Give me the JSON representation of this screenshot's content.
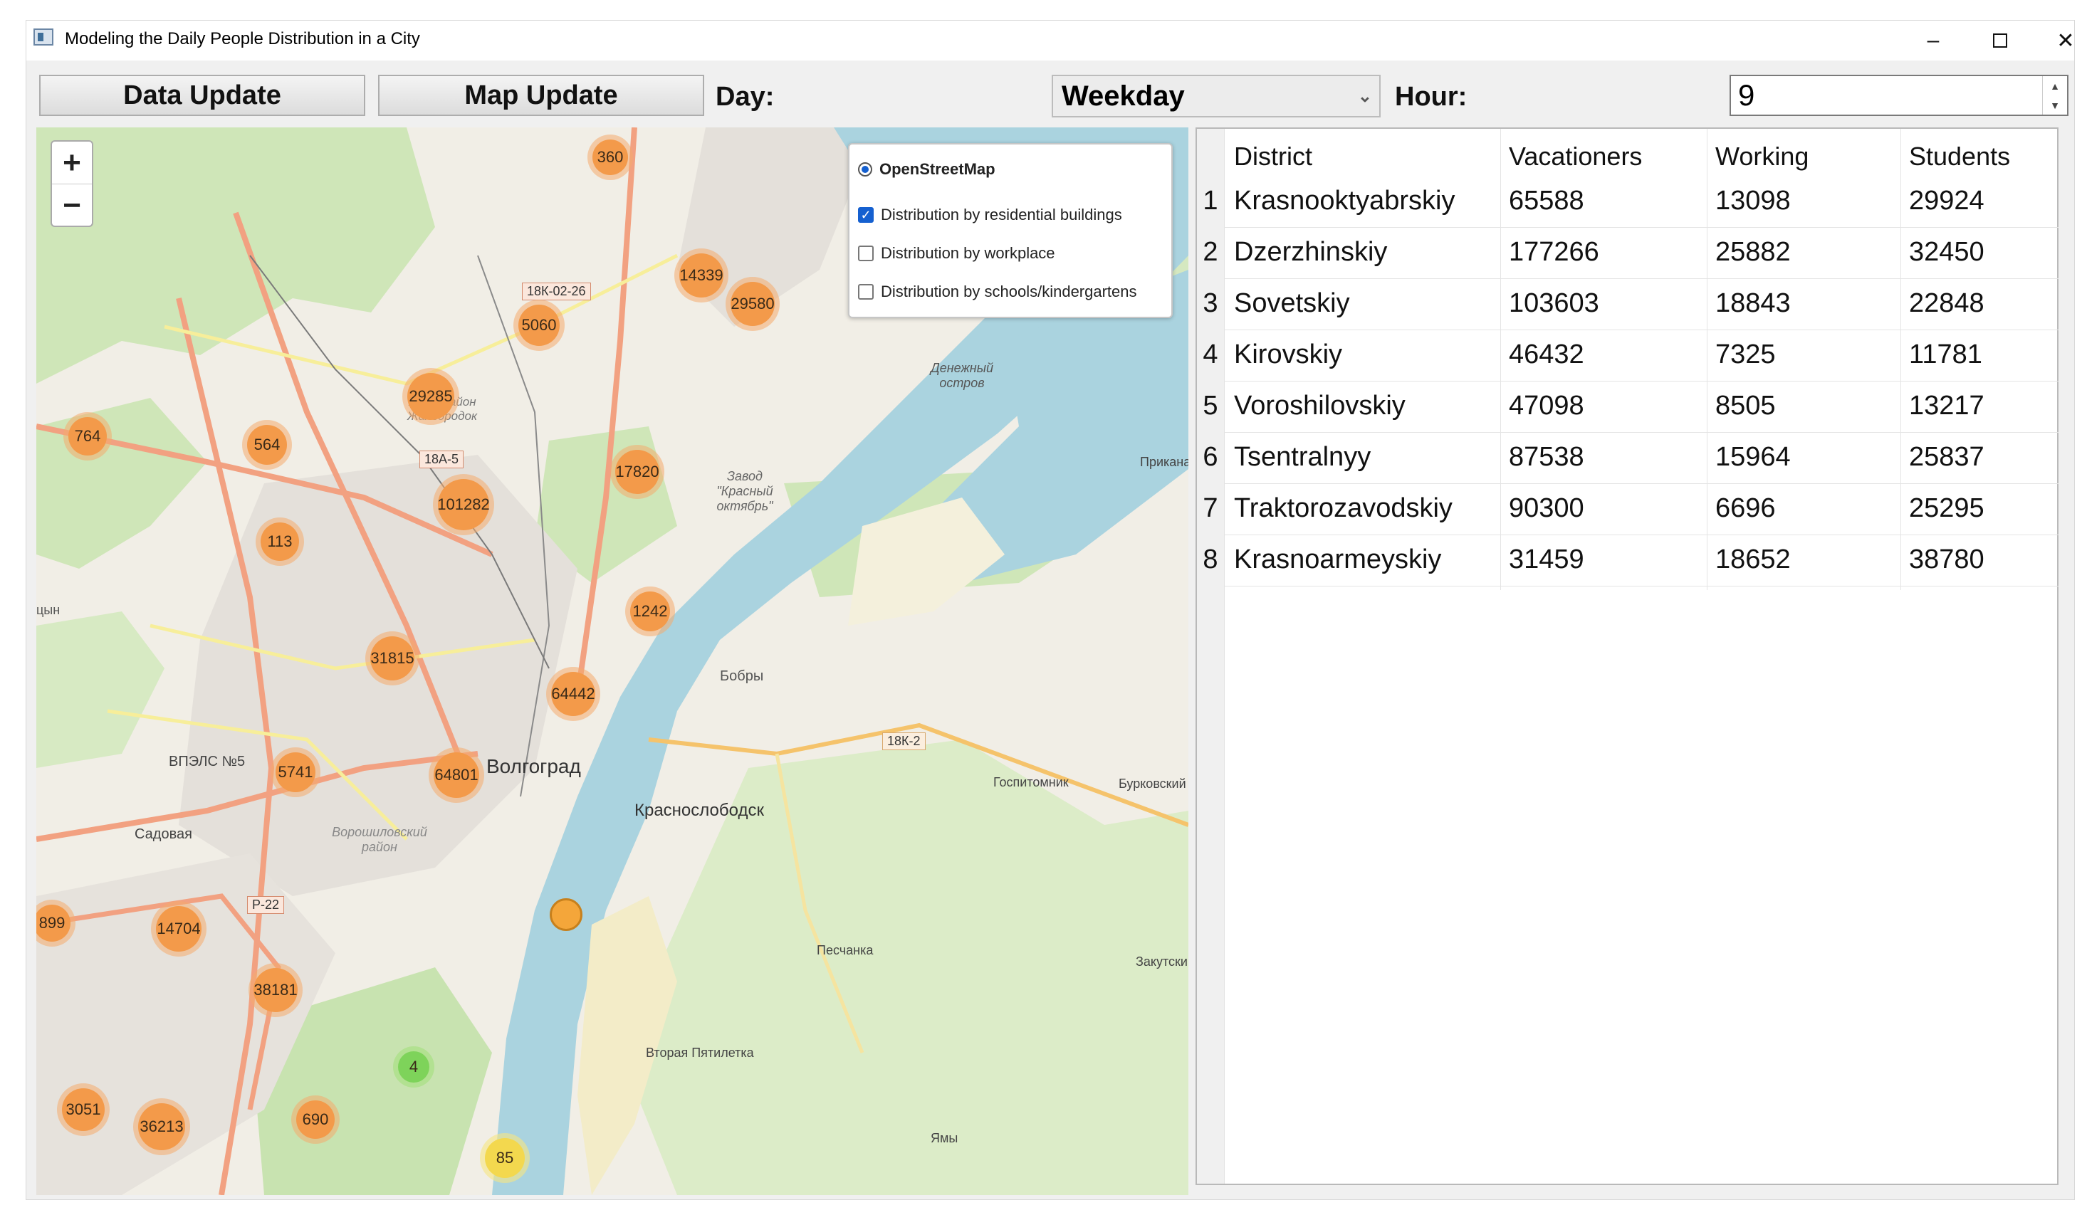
{
  "window": {
    "title": "Modeling the Daily People Distribution in a City"
  },
  "toolbar": {
    "data_update": "Data Update",
    "map_update": "Map Update",
    "day_label": "Day:",
    "day_value": "Weekday",
    "hour_label": "Hour:",
    "hour_value": "9"
  },
  "map": {
    "zoom_in": "+",
    "zoom_out": "−",
    "layers": {
      "base": "OpenStreetMap",
      "overlays": [
        {
          "label": "Distribution by residential buildings",
          "checked": true
        },
        {
          "label": "Distribution by workplace",
          "checked": false
        },
        {
          "label": "Distribution by schools/kindergartens",
          "checked": false
        }
      ]
    },
    "place_labels": [
      "Волгоград",
      "Краснослободск",
      "Бобры",
      "Денежный остров",
      "Завод \"Красный октябрь\"",
      "ВПЭЛС №5",
      "Садовая",
      "Ворошиловский район",
      "Госпитомник",
      "Бурковский",
      "Песчанка",
      "Вторая Пятилетка",
      "Ямы",
      "Закутский",
      "Приканальный",
      "микрорайон Жилгородок",
      "цын"
    ],
    "road_labels": [
      "18К-02-26",
      "18А-5",
      "18К-2",
      "Р-22"
    ],
    "clusters": [
      {
        "label": "360",
        "color": "orange"
      },
      {
        "label": "14339",
        "color": "orange"
      },
      {
        "label": "29580",
        "color": "orange"
      },
      {
        "label": "5060",
        "color": "orange"
      },
      {
        "label": "29285",
        "color": "orange"
      },
      {
        "label": "764",
        "color": "orange"
      },
      {
        "label": "564",
        "color": "orange"
      },
      {
        "label": "17820",
        "color": "orange"
      },
      {
        "label": "101282",
        "color": "orange"
      },
      {
        "label": "113",
        "color": "orange"
      },
      {
        "label": "1242",
        "color": "orange"
      },
      {
        "label": "31815",
        "color": "orange"
      },
      {
        "label": "64442",
        "color": "orange"
      },
      {
        "label": "5741",
        "color": "orange"
      },
      {
        "label": "64801",
        "color": "orange"
      },
      {
        "label": "899",
        "color": "orange"
      },
      {
        "label": "14704",
        "color": "orange"
      },
      {
        "label": "38181",
        "color": "orange"
      },
      {
        "label": "4",
        "color": "green"
      },
      {
        "label": "690",
        "color": "orange"
      },
      {
        "label": "3051",
        "color": "orange"
      },
      {
        "label": "36213",
        "color": "orange"
      },
      {
        "label": "85",
        "color": "yellow"
      },
      {
        "label": "",
        "color": "orange-marker"
      }
    ]
  },
  "table": {
    "headers": [
      "District",
      "Vacationers",
      "Working",
      "Students"
    ],
    "rows": [
      [
        "1",
        "Krasnooktyabrskiy",
        "65588",
        "13098",
        "29924"
      ],
      [
        "2",
        "Dzerzhinskiy",
        "177266",
        "25882",
        "32450"
      ],
      [
        "3",
        "Sovetskiy",
        "103603",
        "18843",
        "22848"
      ],
      [
        "4",
        "Kirovskiy",
        "46432",
        "7325",
        "11781"
      ],
      [
        "5",
        "Voroshilovskiy",
        "47098",
        "8505",
        "13217"
      ],
      [
        "6",
        "Tsentralnyy",
        "87538",
        "15964",
        "25837"
      ],
      [
        "7",
        "Traktorozavodskiy",
        "90300",
        "6696",
        "25295"
      ],
      [
        "8",
        "Krasnoarmeyskiy",
        "31459",
        "18652",
        "38780"
      ]
    ]
  },
  "colors": {
    "cluster_orange": "#f39a4a",
    "cluster_green": "#7ed35a",
    "cluster_yellow": "#f3d84e",
    "river": "#aad3df",
    "checked_blue": "#1560d0"
  }
}
